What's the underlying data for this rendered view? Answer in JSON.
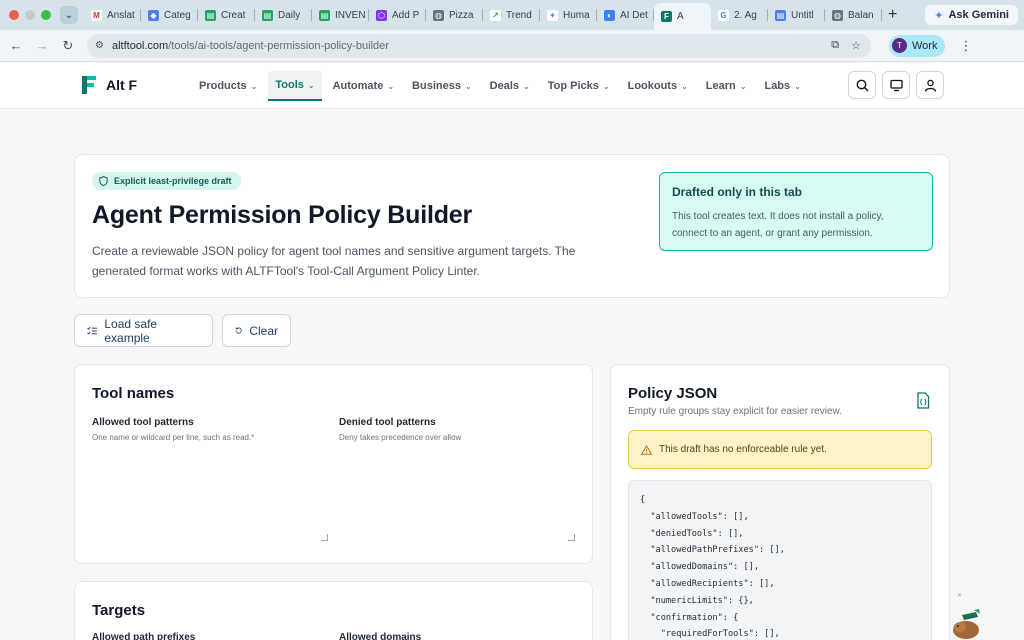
{
  "browser": {
    "tabs": [
      {
        "label": "Anslat",
        "favicon_color": "#ffffff",
        "favicon_text": "M",
        "favicon_fg": "#d93025"
      },
      {
        "label": "Categ",
        "favicon_color": "#4f7df3",
        "favicon_text": "◆",
        "favicon_fg": "#ffffff"
      },
      {
        "label": "Creat",
        "favicon_color": "#1fa463",
        "favicon_text": "▤",
        "favicon_fg": "#ffffff"
      },
      {
        "label": "Daily",
        "favicon_color": "#1fa463",
        "favicon_text": "▤",
        "favicon_fg": "#ffffff"
      },
      {
        "label": "INVEN",
        "favicon_color": "#1fa463",
        "favicon_text": "▤",
        "favicon_fg": "#ffffff"
      },
      {
        "label": "Add P",
        "favicon_color": "#7c3aed",
        "favicon_text": "⬡",
        "favicon_fg": "#ffffff"
      },
      {
        "label": "Pizza",
        "favicon_color": "#6b7280",
        "favicon_text": "◍",
        "favicon_fg": "#ffffff"
      },
      {
        "label": "Trend",
        "favicon_color": "#ffffff",
        "favicon_text": "↗",
        "favicon_fg": "#16a34a"
      },
      {
        "label": "Huma",
        "favicon_color": "#ffffff",
        "favicon_text": "✦",
        "favicon_fg": "#4f7df3"
      },
      {
        "label": "AI Det",
        "favicon_color": "#3b82f6",
        "favicon_text": "◐",
        "favicon_fg": "#ffffff"
      },
      {
        "label": "A",
        "favicon_color": "#0f766e",
        "favicon_text": "F",
        "favicon_fg": "#ffffff",
        "active": true
      },
      {
        "label": "2. Ag",
        "favicon_color": "#ffffff",
        "favicon_text": "G",
        "favicon_fg": "#4285f4"
      },
      {
        "label": "Untitl",
        "favicon_color": "#4f7df3",
        "favicon_text": "▤",
        "favicon_fg": "#ffffff"
      },
      {
        "label": "Balan",
        "favicon_color": "#6b7280",
        "favicon_text": "◍",
        "favicon_fg": "#ffffff"
      }
    ],
    "gemini_label": "Ask Gemini",
    "url_host": "altftool.com",
    "url_path": "/tools/ai-tools/agent-permission-policy-builder",
    "profile_initial": "T",
    "profile_label": "Work"
  },
  "site": {
    "logo_text": "Alt F",
    "nav": [
      {
        "label": "Products",
        "active": false
      },
      {
        "label": "Tools",
        "active": true
      },
      {
        "label": "Automate",
        "active": false
      },
      {
        "label": "Business",
        "active": false
      },
      {
        "label": "Deals",
        "active": false
      },
      {
        "label": "Top Picks",
        "active": false
      },
      {
        "label": "Lookouts",
        "active": false
      },
      {
        "label": "Learn",
        "active": false
      },
      {
        "label": "Labs",
        "active": false
      }
    ]
  },
  "hero": {
    "badge": "Explicit least-privilege draft",
    "title": "Agent Permission Policy Builder",
    "description": "Create a reviewable JSON policy for agent tool names and sensitive argument targets. The generated format works with ALTFTool's Tool-Call Argument Policy Linter.",
    "notice_title": "Drafted only in this tab",
    "notice_body": "This tool creates text. It does not install a policy, connect to an agent, or grant any permission."
  },
  "actions": {
    "load_example": "Load safe example",
    "clear": "Clear"
  },
  "tool_names": {
    "title": "Tool names",
    "allowed_label": "Allowed tool patterns",
    "allowed_help": "One name or wildcard per line, such as read.*",
    "denied_label": "Denied tool patterns",
    "denied_help": "Deny takes precedence over allow"
  },
  "targets": {
    "title": "Targets",
    "path_label": "Allowed path prefixes",
    "domains_label": "Allowed domains"
  },
  "policy": {
    "title": "Policy JSON",
    "subtitle": "Empty rule groups stay explicit for easier review.",
    "warning": "This draft has no enforceable rule yet.",
    "json_text": "{\n  \"allowedTools\": [],\n  \"deniedTools\": [],\n  \"allowedPathPrefixes\": [],\n  \"allowedDomains\": [],\n  \"allowedRecipients\": [],\n  \"numericLimits\": {},\n  \"confirmation\": {\n    \"requiredForTools\": [],"
  },
  "colors": {
    "accent": "#0f766e",
    "notice_bg": "#d7faf3",
    "warning_bg": "#fef3c7"
  }
}
